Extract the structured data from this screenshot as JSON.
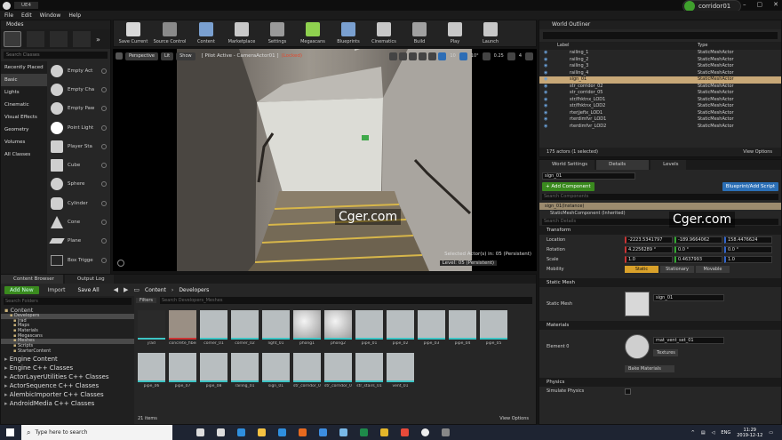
{
  "app": {
    "title": "UE4",
    "menu": [
      "File",
      "Edit",
      "Window",
      "Help"
    ],
    "user": "corridor01"
  },
  "toolbar": [
    {
      "label": "Save Current",
      "icon": "save-icon",
      "color": "#d8d8d8"
    },
    {
      "label": "Source Control",
      "icon": "source-control-icon",
      "color": "#8a8a8a"
    },
    {
      "label": "Content",
      "icon": "content-icon",
      "color": "#7aa0d0"
    },
    {
      "label": "Marketplace",
      "icon": "marketplace-icon",
      "color": "#c8c8c8"
    },
    {
      "label": "Settings",
      "icon": "settings-icon",
      "color": "#9a9a9a"
    },
    {
      "label": "Megascans",
      "icon": "megascans-icon",
      "color": "#8fd14f"
    },
    {
      "label": "Blueprints",
      "icon": "blueprints-icon",
      "color": "#7aa0d0"
    },
    {
      "label": "Cinematics",
      "icon": "cinematics-icon",
      "color": "#c8c8c8"
    },
    {
      "label": "Build",
      "icon": "build-icon",
      "color": "#a0a0a0"
    },
    {
      "label": "Play",
      "icon": "play-icon",
      "color": "#c8c8c8"
    },
    {
      "label": "Launch",
      "icon": "launch-icon",
      "color": "#c8c8c8"
    }
  ],
  "modes": {
    "tab": "Modes",
    "search_placeholder": "Search Classes",
    "categories": [
      "Recently Placed",
      "Basic",
      "Lights",
      "Cinematic",
      "Visual Effects",
      "Geometry",
      "Volumes",
      "All Classes"
    ],
    "selected_category": "Basic",
    "actors": [
      "Empty Act",
      "Empty Cha",
      "Empty Paw",
      "Point Light",
      "Player Sta",
      "Cube",
      "Sphere",
      "Cylinder",
      "Cone",
      "Plane",
      "Box Trigge"
    ]
  },
  "viewport": {
    "perspective": "Perspective",
    "lit": "Lit",
    "show": "Show",
    "pilot": "[ Pilot Active - CameraActor01 ]",
    "locked": "(Locked)",
    "grid": "10",
    "rot": "10°",
    "scale": "0.25",
    "cam": "4",
    "selected": "Selected Actor(s) in:  05 (Persistent)",
    "level": "Level:  05 (Persistent)",
    "watermark": "Cger.com"
  },
  "outliner": {
    "tab": "World Outliner",
    "col_label": "Label",
    "col_type": "Type",
    "rows": [
      {
        "label": "railing_1",
        "type": "StaticMeshActor"
      },
      {
        "label": "railing_2",
        "type": "StaticMeshActor"
      },
      {
        "label": "railing_3",
        "type": "StaticMeshActor"
      },
      {
        "label": "railing_4",
        "type": "StaticMeshActor"
      },
      {
        "label": "sign_01",
        "type": "StaticMeshActor",
        "selected": true
      },
      {
        "label": "str_corridor_02",
        "type": "StaticMeshActor"
      },
      {
        "label": "str_corridor_05",
        "type": "StaticMeshActor"
      },
      {
        "label": "str/fhktnx_LOD1",
        "type": "StaticMeshActor"
      },
      {
        "label": "str/fhktnx_LOD2",
        "type": "StaticMeshActor"
      },
      {
        "label": "rterjjefix_LOD1",
        "type": "StaticMeshActor"
      },
      {
        "label": "rterdimfvr_LOD1",
        "type": "StaticMeshActor"
      },
      {
        "label": "rterdimfvr_LOD2",
        "type": "StaticMeshActor"
      }
    ],
    "count": "175 actors (1 selected)",
    "view_options": "View Options"
  },
  "details": {
    "tabs": [
      "World Settings",
      "Details",
      "Levels"
    ],
    "name": "sign_01",
    "add_component": "+ Add Component",
    "blueprint": "Blueprint/Add Script",
    "search_components": "Search Components",
    "instance": "sign_01(Instance)",
    "component": "StaticMeshComponent (Inherited)",
    "search_details": "Search Details",
    "transform": "Transform",
    "location": {
      "label": "Location",
      "x": "-2223.5341797",
      "y": "-189.9664062",
      "z": "158.4476624"
    },
    "rotation": {
      "label": "Rotation",
      "x": "4.2256289 °",
      "y": "0.0 °",
      "z": "0.0 °"
    },
    "scale": {
      "label": "Scale",
      "x": "1.0",
      "y": "0.4637993",
      "z": "1.0"
    },
    "mobility": {
      "label": "Mobility",
      "options": [
        "Static",
        "Stationary",
        "Movable"
      ],
      "active": "Static"
    },
    "static_mesh_section": "Static Mesh",
    "static_mesh_label": "Static Mesh",
    "static_mesh_value": "sign_01",
    "materials_section": "Materials",
    "element_label": "Element 0",
    "material_value": "mat_vent_set_01",
    "textures": "Textures",
    "bake": "Bake Materials",
    "physics_section": "Physics",
    "simulate": "Simulate Physics",
    "watermark": "Cger.com"
  },
  "content_browser": {
    "tabs": [
      "Content Browser",
      "Output Log"
    ],
    "add_new": "Add New",
    "import": "Import",
    "save_all": "Save All",
    "breadcrumb": [
      "Content",
      "Developers"
    ],
    "search_folders": "Search Folders",
    "filters": "Filters",
    "search_assets": "Search Developers_Meshes",
    "folders": [
      "Content",
      "Developers",
      "jrad",
      "Maps",
      "Materials",
      "Megascans",
      "Meshes",
      "Scripts",
      "StarterContent"
    ],
    "classes": [
      "Engine Content",
      "Engine C++ Classes",
      "ActorLayerUtilities C++ Classes",
      "ActorSequence C++ Classes",
      "AlembicImporter C++ Classes",
      "AndroidMedia C++ Classes"
    ],
    "assets": [
      "jrad",
      "concrete_fiber_01_Albedo",
      "corner_01",
      "corner_02",
      "light_01",
      "phong1",
      "phong2",
      "pipe_01",
      "pipe_02",
      "pipe_03",
      "pipe_04",
      "pipe_05",
      "pipe_06",
      "pipe_07",
      "pipe_08",
      "railing_01",
      "sign_01",
      "str_corridor_04",
      "str_corridor_05",
      "str_stairs_01",
      "vent_01"
    ],
    "count": "21 items",
    "view_options": "View Options"
  },
  "taskbar": {
    "search": "Type here to search",
    "time": "11:29",
    "date": "2019-12-12",
    "lang": "ENG"
  }
}
